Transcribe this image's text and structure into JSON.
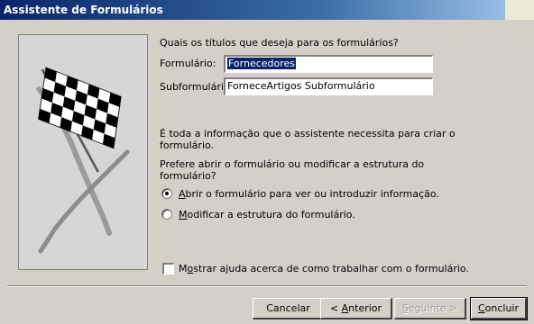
{
  "window": {
    "title": "Assistente de Formulários"
  },
  "intro": {
    "question": "Quais os títulos que deseja para os formulários?"
  },
  "form": {
    "formulario_label": "Formulário:",
    "formulario_value": "Fornecedores",
    "subformulario_label": "Subformulário:",
    "subformulario_value": "ForneceArtigos Subformulário"
  },
  "info": {
    "line1": "É toda a informação que o assistente necessita para criar o",
    "line2": "formulário.",
    "prefer1": "Prefere abrir o formulário ou modificar a estrutura do",
    "prefer2": "formulário?"
  },
  "options": {
    "open_accel": "A",
    "open_rest": "brir o formulário para ver ou introduzir informação.",
    "modify_accel": "M",
    "modify_rest": "odificar a estrutura do formulário.",
    "selected": "open"
  },
  "help": {
    "pre": "M",
    "accel": "o",
    "rest": "strar ajuda acerca de como trabalhar com o formulário.",
    "checked": false
  },
  "buttons": {
    "cancel": "Cancelar",
    "back_prefix": "< ",
    "back_accel": "A",
    "back_rest": "nterior",
    "next_accel": "S",
    "next_rest": "eguinte >",
    "finish_accel": "C",
    "finish_rest": "oncluir"
  },
  "colors": {
    "titlebar": "#0a246a",
    "selection": "#0a246a",
    "dialog": "#d4d0c8"
  },
  "icons": {
    "picture": "checkered-flag-icon"
  }
}
